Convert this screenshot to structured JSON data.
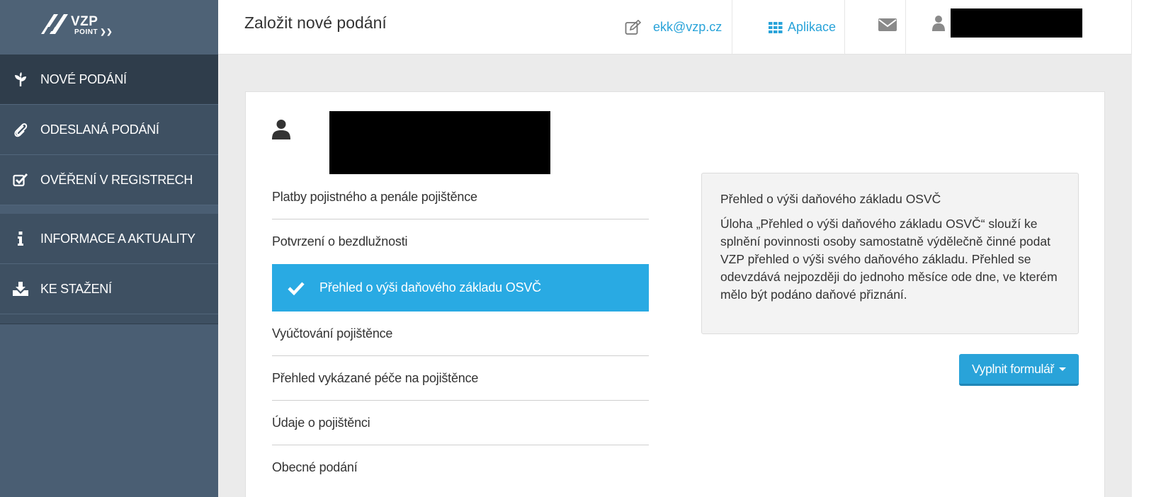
{
  "logo": {
    "brand": "VZP",
    "sub": "POINT"
  },
  "sidebar": {
    "items": [
      {
        "label": "NOVÉ PODÁNÍ",
        "icon": "plant-icon",
        "active": true
      },
      {
        "label": "ODESLANÁ PODÁNÍ",
        "icon": "paperclip-icon"
      },
      {
        "label": "OVĚŘENÍ V REGISTRECH",
        "icon": "check-square-icon"
      },
      {
        "label": "INFORMACE A AKTUALITY",
        "icon": "info-icon"
      },
      {
        "label": "KE STAŽENÍ",
        "icon": "download-icon"
      }
    ]
  },
  "header": {
    "title": "Založit nové podání",
    "user_email": "ekk@vzp.cz",
    "apps_label": "Aplikace"
  },
  "list": {
    "items": [
      {
        "label": "Platby pojistného a penále pojištěnce"
      },
      {
        "label": "Potvrzení o bezdlužnosti"
      },
      {
        "label": "Přehled o výši daňového základu OSVČ",
        "selected": true
      },
      {
        "label": "Vyúčtování pojištěnce"
      },
      {
        "label": "Přehled vykázané péče na pojištěnce"
      },
      {
        "label": "Údaje o pojištěnci"
      },
      {
        "label": "Obecné podání"
      }
    ]
  },
  "info": {
    "title": "Přehled o výši daňového základu OSVČ",
    "description": "Úloha „Přehled o výši daňového základu OSVČ“ slouží ke splnění povinnosti osoby samostatně výdělečně činné podat VZP přehled o výši svého daňového základu. Přehled se odevzdává nejpozději do jednoho měsíce ode dne, ve kterém mělo být podáno daňové přiznání."
  },
  "action": {
    "label": "Vyplnit formulář"
  },
  "colors": {
    "accent": "#29a3d9",
    "sidebar": "#4a5e73",
    "sidebar_active": "#2f3d4b"
  }
}
